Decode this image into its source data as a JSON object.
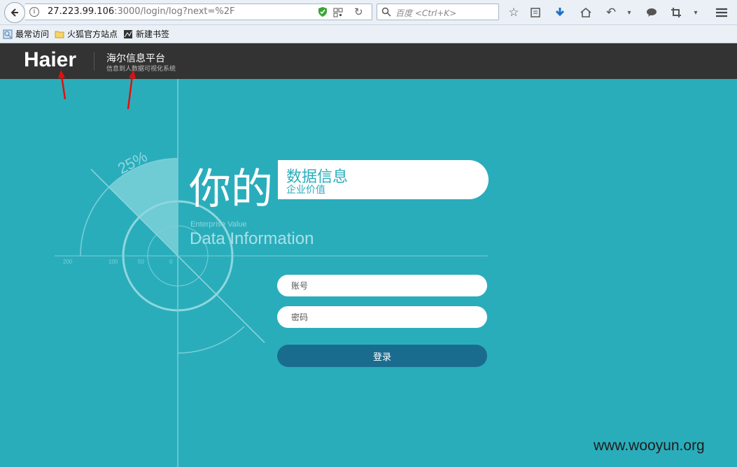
{
  "browser": {
    "url_host": "27.223.99.106",
    "url_rest": ":3000/login/log?next=%2F",
    "search_placeholder": "百度 <Ctrl+K>"
  },
  "bookmarks": [
    "最常访问",
    "火狐官方站点",
    "新建书签"
  ],
  "header": {
    "logo": "Haier",
    "title": "海尔信息平台",
    "subtitle": "信息到人数据可视化系统"
  },
  "hero": {
    "big": "你的",
    "pill_title": "数据信息",
    "pill_sub": "企业价值",
    "en_small": "Enterprise Value",
    "en_big": "Data Information",
    "percent": "25%",
    "ticks": [
      "200",
      "100",
      "50",
      "0"
    ]
  },
  "form": {
    "account_placeholder": "账号",
    "password_placeholder": "密码",
    "login_label": "登录"
  },
  "watermark": "www.wooyun.org",
  "colors": {
    "background": "#2aadbb",
    "header": "#333333",
    "button": "#1a6c8e"
  }
}
